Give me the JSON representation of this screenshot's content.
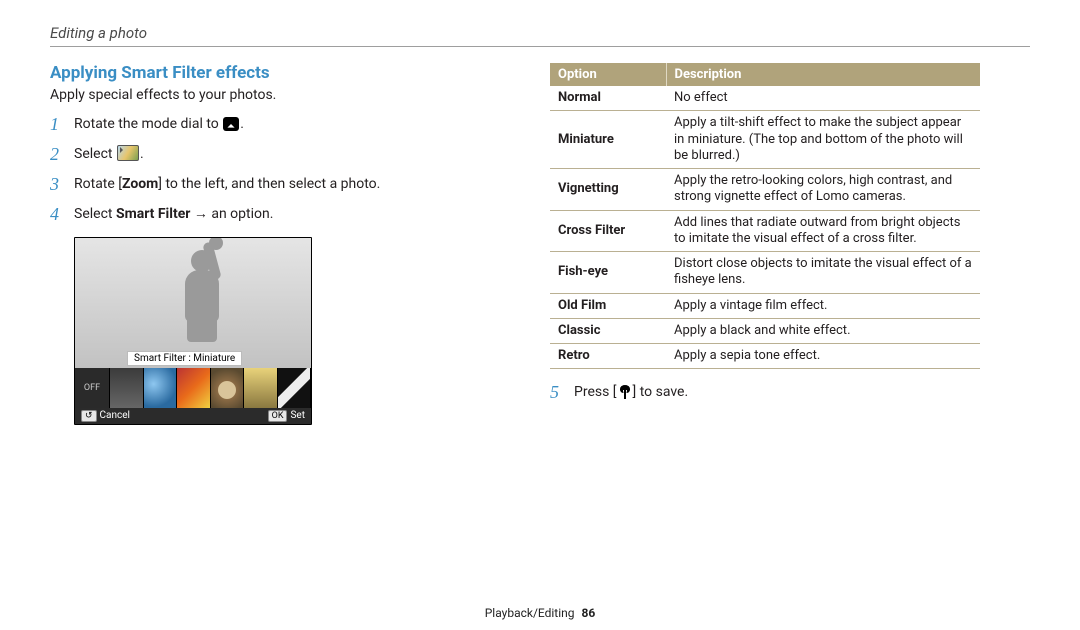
{
  "header": {
    "section": "Editing a photo"
  },
  "footer": {
    "chapter": "Playback/Editing",
    "page": "86"
  },
  "subheading": "Applying Smart Filter effects",
  "lead": "Apply special effects to your photos.",
  "steps": {
    "s1_a": "Rotate the mode dial to ",
    "s1_b": ".",
    "s2_a": "Select ",
    "s2_b": ".",
    "s3_a": "Rotate [",
    "s3_zoom": "Zoom",
    "s3_b": "] to the left, and then select a photo.",
    "s4_a": "Select ",
    "s4_sf": "Smart Filter",
    "s4_b": " → an option.",
    "s5_a": "Press [",
    "s5_b": "] to save."
  },
  "screenshot": {
    "caption": "Smart Filter : Miniature",
    "off": "OFF",
    "cancel": "Cancel",
    "set": "Set",
    "back_key": "↺",
    "ok_key": "OK"
  },
  "table": {
    "thead": {
      "option": "Option",
      "desc": "Description"
    },
    "rows": [
      {
        "opt": "Normal",
        "desc": "No effect"
      },
      {
        "opt": "Miniature",
        "desc": "Apply a tilt-shift effect to make the subject appear in miniature. (The top and bottom of the photo will be blurred.)"
      },
      {
        "opt": "Vignetting",
        "desc": "Apply the retro-looking colors, high contrast, and strong vignette effect of Lomo cameras."
      },
      {
        "opt": "Cross Filter",
        "desc": "Add lines that radiate outward from bright objects to imitate the visual effect of a cross filter."
      },
      {
        "opt": "Fish-eye",
        "desc": "Distort close objects to imitate the visual effect of a fisheye lens."
      },
      {
        "opt": "Old Film",
        "desc": "Apply a vintage film effect."
      },
      {
        "opt": "Classic",
        "desc": "Apply a black and white effect."
      },
      {
        "opt": "Retro",
        "desc": "Apply a sepia tone effect."
      }
    ]
  }
}
